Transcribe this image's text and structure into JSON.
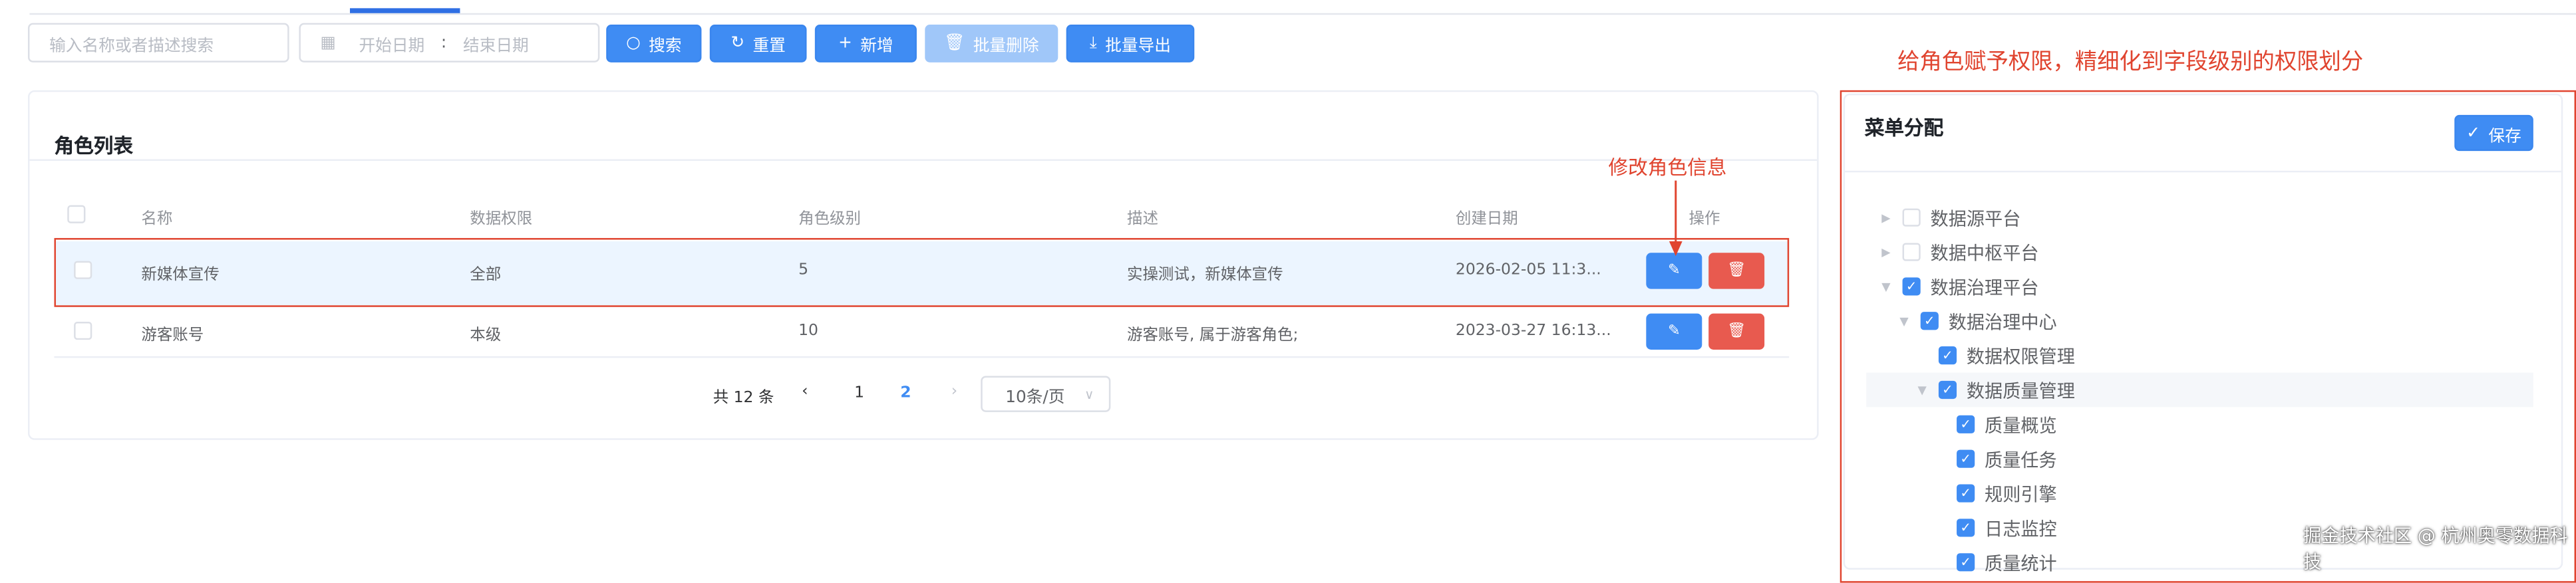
{
  "toolbar": {
    "search_placeholder": "输入名称或者描述搜索",
    "date_start_placeholder": "开始日期",
    "date_separator": ":",
    "date_end_placeholder": "结束日期",
    "search_label": "搜索",
    "reset_label": "重置",
    "add_label": "新增",
    "batch_delete_label": "批量删除",
    "batch_export_label": "批量导出"
  },
  "role_list": {
    "title": "角色列表",
    "columns": [
      "名称",
      "数据权限",
      "角色级别",
      "描述",
      "创建日期",
      "操作"
    ],
    "rows": [
      {
        "name": "新媒体宣传",
        "data_scope": "全部",
        "level": "5",
        "desc": "实操测试，新媒体宣传",
        "created": "2026-02-05 11:3..."
      },
      {
        "name": "游客账号",
        "data_scope": "本级",
        "level": "10",
        "desc": "游客账号, 属于游客角色;",
        "created": "2023-03-27 16:13..."
      }
    ],
    "pagination": {
      "total_text": "共 12 条",
      "pages": [
        "1",
        "2"
      ],
      "current_page": "2",
      "page_size": "10条/页"
    }
  },
  "menu_panel": {
    "title": "菜单分配",
    "save_label": "保存",
    "tree": [
      {
        "label": "数据源平台",
        "level": 0,
        "checked": false,
        "expander": "collapsed"
      },
      {
        "label": "数据中枢平台",
        "level": 0,
        "checked": false,
        "expander": "collapsed"
      },
      {
        "label": "数据治理平台",
        "level": 0,
        "checked": true,
        "expander": "expanded"
      },
      {
        "label": "数据治理中心",
        "level": 1,
        "checked": true,
        "expander": "expanded"
      },
      {
        "label": "数据权限管理",
        "level": 2,
        "checked": true,
        "expander": "none"
      },
      {
        "label": "数据质量管理",
        "level": 2,
        "checked": true,
        "expander": "expanded"
      },
      {
        "label": "质量概览",
        "level": 3,
        "checked": true,
        "expander": "none"
      },
      {
        "label": "质量任务",
        "level": 3,
        "checked": true,
        "expander": "none"
      },
      {
        "label": "规则引擎",
        "level": 3,
        "checked": true,
        "expander": "none"
      },
      {
        "label": "日志监控",
        "level": 3,
        "checked": true,
        "expander": "none"
      },
      {
        "label": "质量统计",
        "level": 3,
        "checked": true,
        "expander": "none"
      }
    ]
  },
  "annotations": {
    "edit_note": "修改角色信息",
    "permission_note": "给角色赋予权限，精细化到字段级别的权限划分"
  },
  "watermark": "掘金技术社区 @ 杭州奥零数据科技",
  "colors": {
    "primary": "#3f8cf3",
    "danger": "#e85a4f",
    "annotation": "#e0442f",
    "row_highlight": "#ecf5ff"
  }
}
